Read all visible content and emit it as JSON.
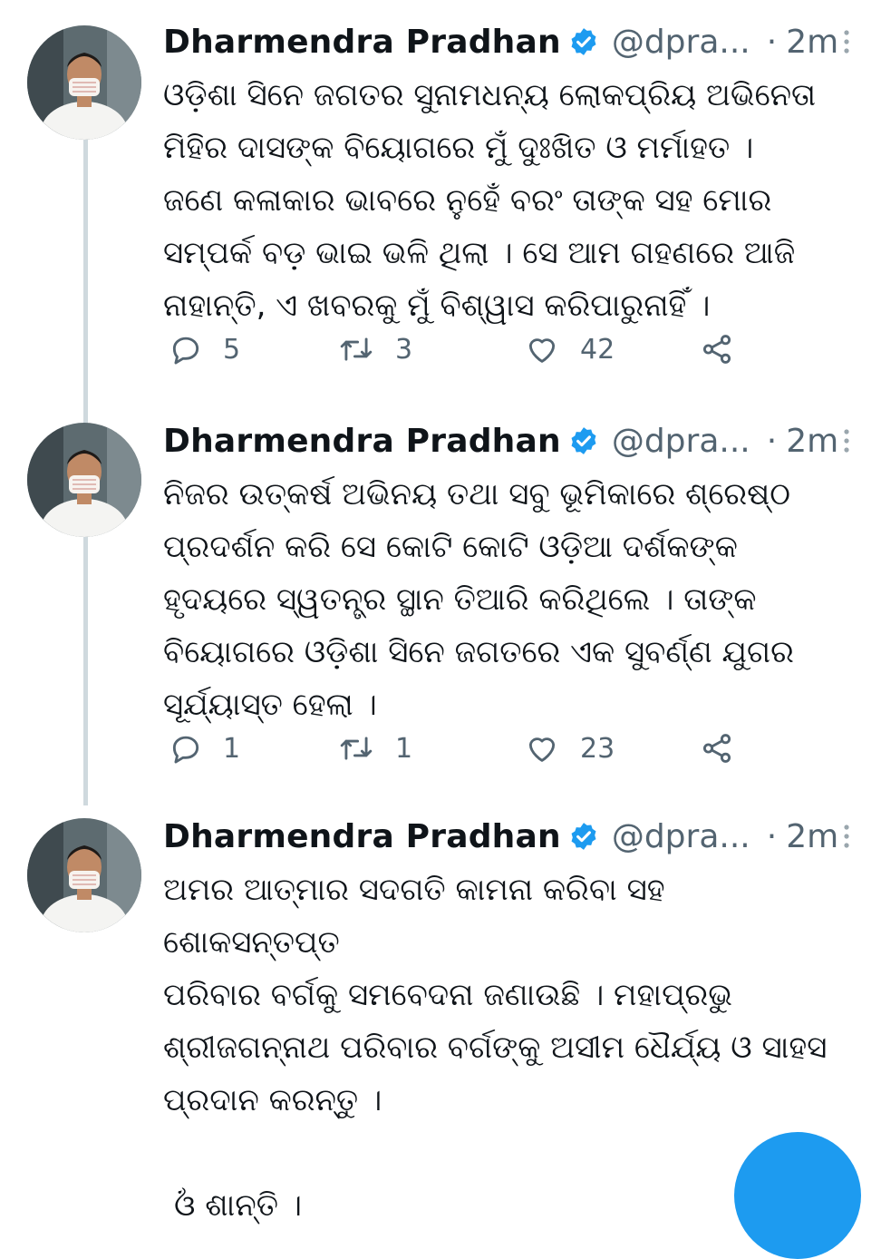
{
  "accent_color": "#1d9bf0",
  "tweets": [
    {
      "author": {
        "name": "Dharmendra Pradhan",
        "handle": "@dpra...",
        "verified": true
      },
      "time": "2m",
      "text_lines": [
        "ଓଡ଼ିଶା ସିନେ ଜଗତର ସୁନାମଧନ୍ୟ ଲୋକପ୍ରିୟ ଅଭିନେତା",
        "ମିହିର ଦାସଙ୍କ ବିୟୋଗରେ ମୁଁ ଦୁଃଖିତ ଓ ମର୍ମାହତ ।",
        "ଜଣେ କଳାକାର ଭାବରେ ନୁହେଁ ବରଂ ତାଙ୍କ ସହ ମୋର",
        "ସମ୍ପର୍କ ବଡ଼ ଭାଇ ଭଳି ଥିଲା । ସେ ଆମ ଗହଣରେ ଆଜି",
        "ନାହାନ୍ତି, ଏ ଖବରକୁ ମୁଁ ବିଶ୍ୱାସ କରିପାରୁନାହିଁ ।"
      ],
      "stats": {
        "replies": "5",
        "retweets": "3",
        "likes": "42"
      }
    },
    {
      "author": {
        "name": "Dharmendra Pradhan",
        "handle": "@dpra...",
        "verified": true
      },
      "time": "2m",
      "text_lines": [
        "ନିଜର ଉତ୍କର୍ଷ ଅଭିନୟ ତଥା ସବୁ ଭୂମିକାରେ ଶ୍ରେଷ୍ଠ",
        "ପ୍ରଦର୍ଶନ କରି ସେ କୋଟି କୋଟି ଓଡ଼ିଆ ଦର୍ଶକଙ୍କ",
        "ହୃଦୟରେ ସ୍ୱତନ୍ତ୍ର ସ୍ଥାନ ତିଆରି କରିଥିଲେ । ତାଙ୍କ",
        "ବିୟୋଗରେ ଓଡ଼ିଶା ସିନେ ଜଗତରେ ଏକ ସୁବର୍ଣ୍ଣ ଯୁଗର",
        "ସୂର୍ଯ୍ୟାସ୍ତ ହେଲା ।"
      ],
      "stats": {
        "replies": "1",
        "retweets": "1",
        "likes": "23"
      }
    },
    {
      "author": {
        "name": "Dharmendra Pradhan",
        "handle": "@dpra...",
        "verified": true
      },
      "time": "2m",
      "text_lines": [
        "ଅମର ଆତ୍ମାର ସଦଗତି କାମନା କରିବା ସହ ଶୋକସନ୍ତପ୍ତ",
        "ପରିବାର ବର୍ଗକୁ ସମବେଦନା ଜଣାଉଛି । ମହାପ୍ରଭୁ",
        "ଶ୍ରୀଜଗନ୍ନାଥ ପରିବାର ବର୍ଗଙ୍କୁ ଅସୀମ ଧୈର୍ଯ୍ୟ ଓ ସାହସ",
        "ପ୍ରଦାନ କରନ୍ତୁ ।"
      ],
      "closing_line": "ଓଁ ଶାନ୍ତି ।"
    }
  ]
}
